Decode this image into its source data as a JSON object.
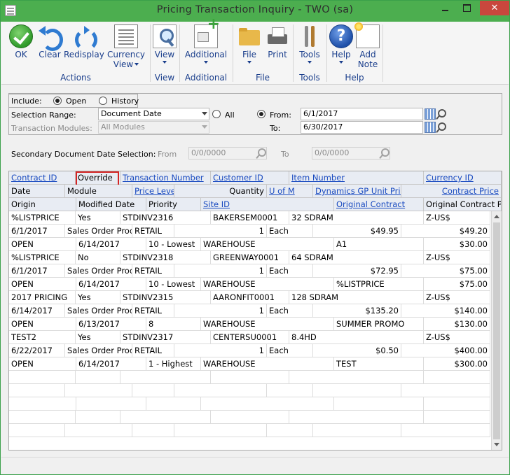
{
  "window": {
    "title": "Pricing Transaction Inquiry  -  TWO (sa)",
    "close_glyph": "✕"
  },
  "ribbon": {
    "buttons": {
      "ok": "OK",
      "clear": "Clear",
      "redisplay": "Redisplay",
      "currency_view_1": "Currency",
      "currency_view_2": "View",
      "view": "View",
      "additional": "Additional",
      "file": "File",
      "print": "Print",
      "tools": "Tools",
      "help": "Help",
      "add_note_1": "Add",
      "add_note_2": "Note",
      "help_glyph": "?"
    },
    "groups": {
      "actions": "Actions",
      "view": "View",
      "additional": "Additional",
      "file": "File",
      "tools": "Tools",
      "help": "Help"
    }
  },
  "form": {
    "include_label": "Include:",
    "open_label": "Open",
    "history_label": "History",
    "selection_range_label": "Selection Range:",
    "selection_range_value": "Document Date",
    "all_label": "All",
    "from_label": "From:",
    "from_value": "6/1/2017",
    "to_label": "To:",
    "to_value": "6/30/2017",
    "transaction_modules_label": "Transaction Modules:",
    "transaction_modules_value": "All Modules",
    "secondary_label": "Secondary Document Date Selection:",
    "sec_from_label": "From",
    "sec_from_value": "0/0/0000",
    "sec_to_label": "To",
    "sec_to_value": "0/0/0000"
  },
  "grid": {
    "header1": [
      "Contract ID",
      "Override",
      "Transaction Number",
      "Customer ID",
      "Item Number",
      "Currency ID"
    ],
    "header2": [
      "Date",
      "Module",
      "Price Level",
      "Quantity",
      "U of M",
      "Dynamics GP Unit Price",
      "Contract Price"
    ],
    "header3": [
      "Origin",
      "Modified Date",
      "Priority",
      "Site ID",
      "Original Contract",
      "Original Contract Price"
    ],
    "records": [
      {
        "r1": [
          "%LISTPRICE",
          "Yes",
          "STDINV2316",
          "BAKERSEM0001",
          "32 SDRAM",
          "Z-US$"
        ],
        "r2": [
          "6/1/2017",
          "Sales Order Processing",
          "RETAIL",
          "1",
          "Each",
          "$49.95",
          "$49.20"
        ],
        "r3": [
          "OPEN",
          "6/14/2017",
          "10 - Lowest",
          "WAREHOUSE",
          "A1",
          "$30.00"
        ]
      },
      {
        "r1": [
          "%LISTPRICE",
          "No",
          "STDINV2318",
          "GREENWAY0001",
          "64 SDRAM",
          "Z-US$"
        ],
        "r2": [
          "6/1/2017",
          "Sales Order Processing",
          "RETAIL",
          "1",
          "Each",
          "$72.95",
          "$75.00"
        ],
        "r3": [
          "OPEN",
          "6/14/2017",
          "10 - Lowest",
          "WAREHOUSE",
          "%LISTPRICE",
          "$75.00"
        ]
      },
      {
        "r1": [
          "2017 PRICING",
          "Yes",
          "STDINV2315",
          "AARONFIT0001",
          "128 SDRAM",
          "Z-US$"
        ],
        "r2": [
          "6/14/2017",
          "Sales Order Processing",
          "RETAIL",
          "1",
          "Each",
          "$135.20",
          "$140.00"
        ],
        "r3": [
          "OPEN",
          "6/13/2017",
          "8",
          "WAREHOUSE",
          "SUMMER PROMO",
          "$130.00"
        ]
      },
      {
        "r1": [
          "TEST2",
          "Yes",
          "STDINV2317",
          "CENTERSU0001",
          "8.4HD",
          "Z-US$"
        ],
        "r2": [
          "6/22/2017",
          "Sales Order Processing",
          "RETAIL",
          "1",
          "Each",
          "$0.50",
          "$400.00"
        ],
        "r3": [
          "OPEN",
          "6/14/2017",
          "1 - Highest",
          "WAREHOUSE",
          "TEST",
          "$300.00"
        ]
      }
    ]
  }
}
